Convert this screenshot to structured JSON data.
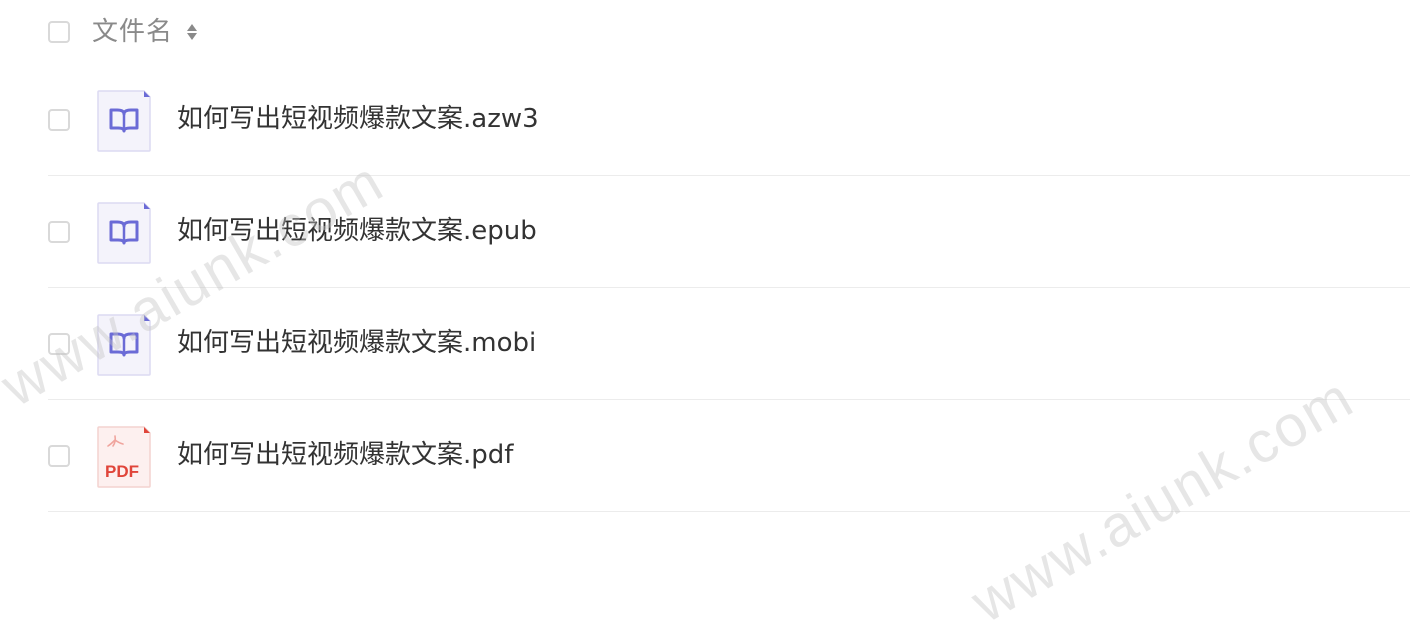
{
  "header": {
    "column_label": "文件名",
    "sort_icon": "sort-up-down-icon"
  },
  "files": [
    {
      "name": "如何写出短视频爆款文案.azw3",
      "icon": "ebook-icon",
      "icon_color": "#6b6bd6"
    },
    {
      "name": "如何写出短视频爆款文案.epub",
      "icon": "ebook-icon",
      "icon_color": "#6b6bd6"
    },
    {
      "name": "如何写出短视频爆款文案.mobi",
      "icon": "ebook-icon",
      "icon_color": "#6b6bd6"
    },
    {
      "name": "如何写出短视频爆款文案.pdf",
      "icon": "pdf-icon",
      "icon_color": "#e0453a",
      "icon_label": "PDF"
    }
  ],
  "watermark": {
    "text": "www.aiunk.com"
  },
  "colors": {
    "ebook_bg": "#f4f3fb",
    "ebook_border": "#dcdaf2",
    "pdf_bg": "#fdf0ef",
    "pdf_border": "#f3d2cf"
  }
}
